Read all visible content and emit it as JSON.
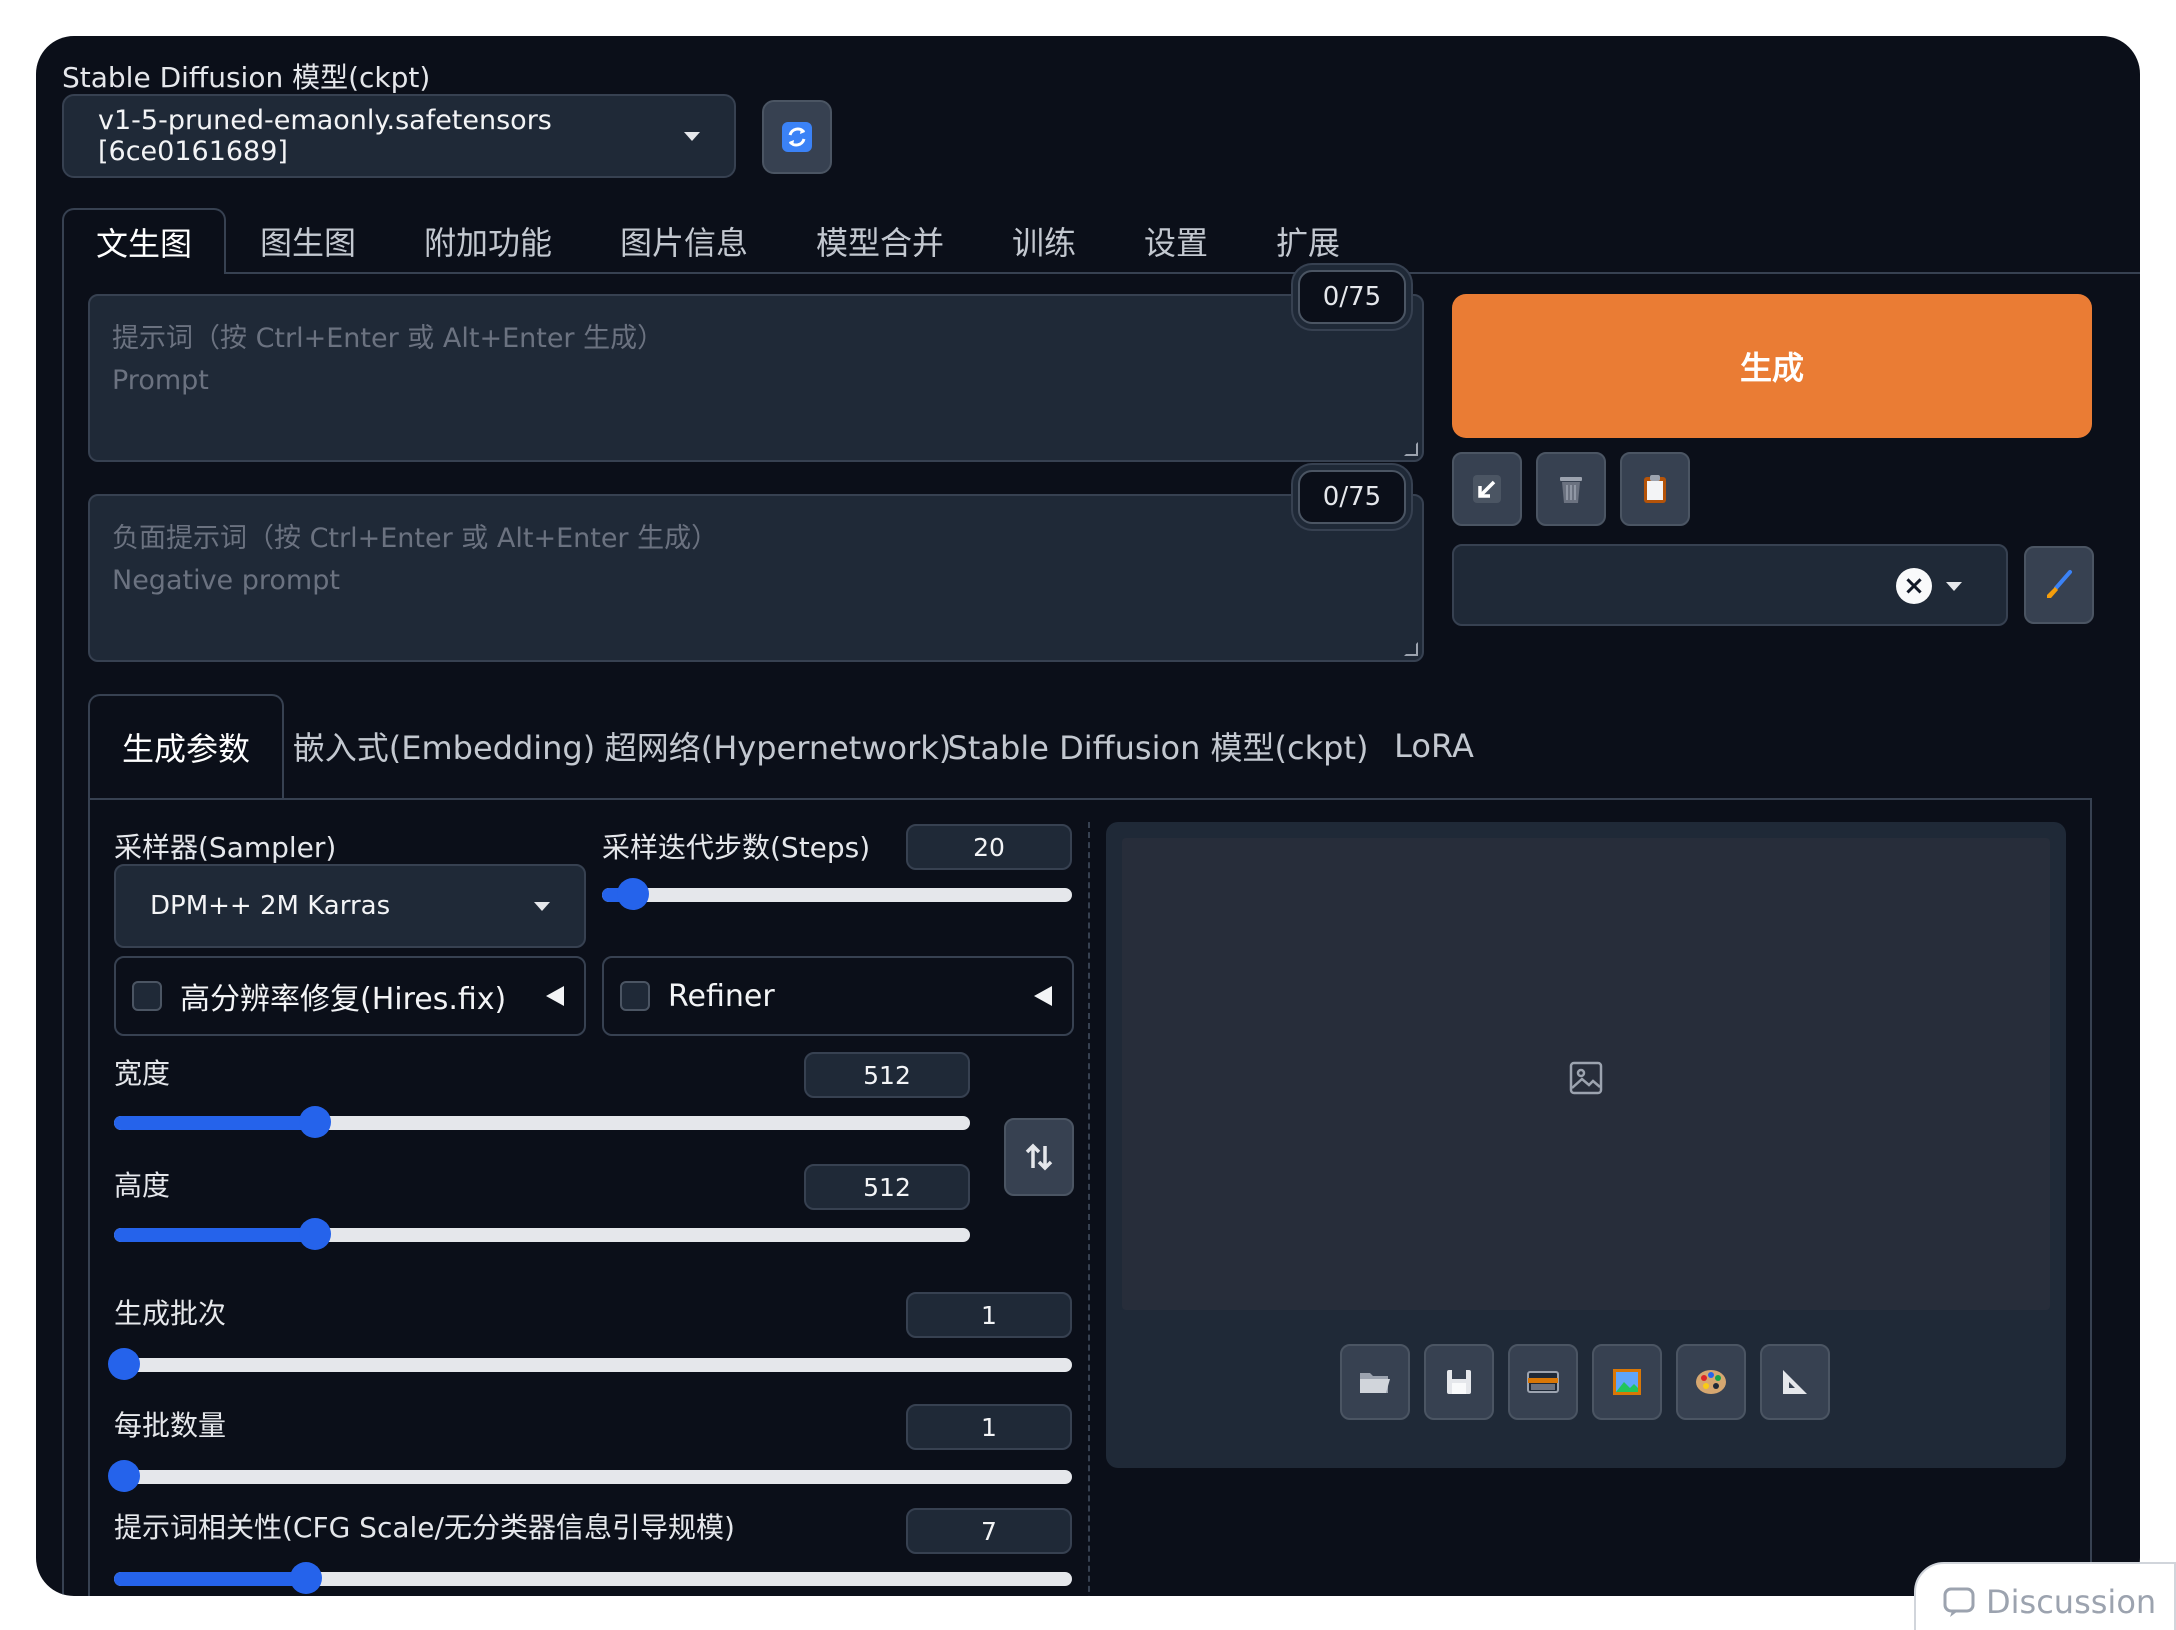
{
  "model": {
    "title": "Stable Diffusion 模型(ckpt)",
    "selected": "v1-5-pruned-emaonly.safetensors [6ce0161689]"
  },
  "tabs": [
    {
      "label": "文生图",
      "active": true
    },
    {
      "label": "图生图"
    },
    {
      "label": "附加功能"
    },
    {
      "label": "图片信息"
    },
    {
      "label": "模型合并"
    },
    {
      "label": "训练"
    },
    {
      "label": "设置"
    },
    {
      "label": "扩展"
    }
  ],
  "prompt": {
    "placeholder_line1": "提示词（按 Ctrl+Enter 或 Alt+Enter 生成）",
    "placeholder_line2": "Prompt",
    "token_count": "0/75"
  },
  "negative_prompt": {
    "placeholder_line1": "负面提示词（按 Ctrl+Enter 或 Alt+Enter 生成）",
    "placeholder_line2": "Negative prompt",
    "token_count": "0/75"
  },
  "generate_label": "生成",
  "styles_clear": "×",
  "subtabs": [
    {
      "label": "生成参数",
      "active": true
    },
    {
      "label": "嵌入式(Embedding)"
    },
    {
      "label": "超网络(Hypernetwork)"
    },
    {
      "label": "Stable Diffusion 模型(ckpt)"
    },
    {
      "label": "LoRA"
    }
  ],
  "params": {
    "sampler_label": "采样器(Sampler)",
    "sampler_value": "DPM++ 2M Karras",
    "steps_label": "采样迭代步数(Steps)",
    "steps_value": "20",
    "steps_fraction": 0.067,
    "hires_label": "高分辨率修复(Hires.fix)",
    "refiner_label": "Refiner",
    "width_label": "宽度",
    "width_value": "512",
    "width_fraction": 0.235,
    "height_label": "高度",
    "height_value": "512",
    "height_fraction": 0.235,
    "batch_count_label": "生成批次",
    "batch_count_value": "1",
    "batch_count_fraction": 0.0,
    "batch_size_label": "每批数量",
    "batch_size_value": "1",
    "batch_size_fraction": 0.0,
    "cfg_label": "提示词相关性(CFG Scale/无分类器信息引导规模)",
    "cfg_value": "7",
    "cfg_fraction": 0.2
  },
  "discussion_label": "Discussion"
}
